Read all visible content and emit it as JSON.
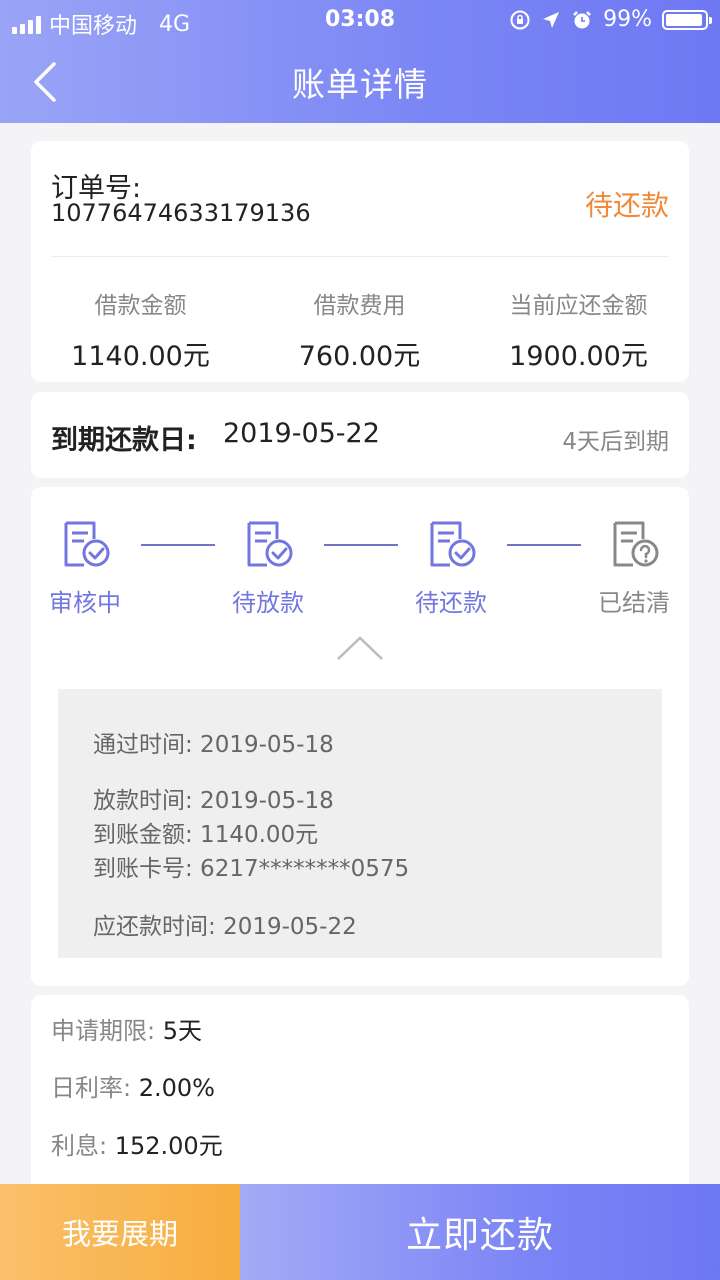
{
  "status_bar": {
    "carrier": "中国移动",
    "network": "4G",
    "time": "03:08",
    "battery": "99%"
  },
  "nav": {
    "title": "账单详情"
  },
  "order": {
    "label": "订单号:",
    "number": "10776474633179136",
    "status": "待还款",
    "amounts": [
      {
        "label": "借款金额",
        "value": "1140.00元"
      },
      {
        "label": "借款费用",
        "value": "760.00元"
      },
      {
        "label": "当前应还金额",
        "value": "1900.00元"
      }
    ]
  },
  "due": {
    "label": "到期还款日:",
    "date": "2019-05-22",
    "remaining": "4天后到期"
  },
  "progress": {
    "steps": [
      {
        "label": "审核中",
        "state": "done"
      },
      {
        "label": "待放款",
        "state": "done"
      },
      {
        "label": "待还款",
        "state": "done"
      },
      {
        "label": "已结清",
        "state": "pending"
      }
    ],
    "details": {
      "pass_time": "通过时间:  2019-05-18",
      "loan_time": "放款时间:  2019-05-18",
      "arrival_amount": "到账金额:  1140.00元",
      "card_no": "到账卡号:  6217********0575",
      "repay_time": "应还款时间:  2019-05-22"
    }
  },
  "info": {
    "term_label": "申请期限: ",
    "term_value": "5天",
    "rate_label": "日利率: ",
    "rate_value": "2.00%",
    "interest_label": "利息: ",
    "interest_value": "152.00元"
  },
  "actions": {
    "extend": "我要展期",
    "repay": "立即还款"
  },
  "colors": {
    "accent": "#7b86f5",
    "step_done": "#7277e0",
    "step_pending": "#888888",
    "status_orange": "#f08a3a",
    "extend_orange": "#f7ad3e"
  }
}
